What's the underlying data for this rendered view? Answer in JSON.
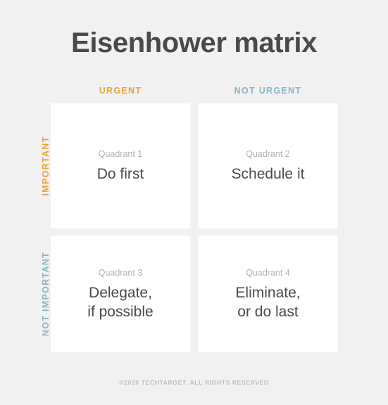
{
  "title": "Eisenhower matrix",
  "colors": {
    "background": "#f1f1f1",
    "card": "#ffffff",
    "urgent_accent": "#e8a33d",
    "not_urgent_accent": "#8cb3c9",
    "heading_text": "#4a4a4d",
    "muted_text": "#b2b2b2",
    "footer_text": "#bdbdbd"
  },
  "axes": {
    "columns": [
      {
        "label": "URGENT",
        "color": "#e8a33d"
      },
      {
        "label": "NOT URGENT",
        "color": "#8cb3c9"
      }
    ],
    "rows": [
      {
        "label": "IMPORTANT",
        "color": "#e8a33d"
      },
      {
        "label": "NOT IMPORTANT",
        "color": "#8cb3c9"
      }
    ]
  },
  "quadrants": [
    {
      "label": "Quadrant 1",
      "action": "Do first"
    },
    {
      "label": "Quadrant 2",
      "action": "Schedule it"
    },
    {
      "label": "Quadrant 3",
      "action": "Delegate,\nif possible"
    },
    {
      "label": "Quadrant 4",
      "action": "Eliminate,\nor do last"
    }
  ],
  "footer": {
    "copyright": "©2020 TECHTARGET. ALL RIGHTS RESERVED"
  }
}
